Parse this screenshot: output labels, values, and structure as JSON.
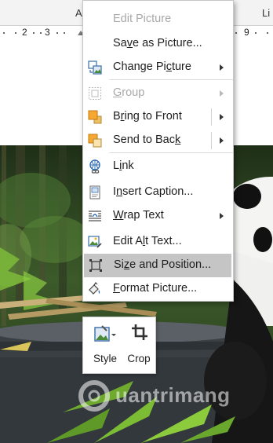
{
  "ribbon": {
    "frag_left": "A",
    "frag_right": "Li"
  },
  "ruler": {
    "numbers": [
      "2",
      "3",
      "9"
    ]
  },
  "context_menu": {
    "items": [
      {
        "label": "Edit Picture",
        "disabled": true,
        "submenu": false,
        "icon": "none"
      },
      {
        "label": "Save as Picture...",
        "disabled": false,
        "submenu": false,
        "icon": "none"
      },
      {
        "label": "Change Picture",
        "disabled": false,
        "submenu": true,
        "icon": "change-picture-icon"
      },
      {
        "label": "Group",
        "disabled": true,
        "submenu": true,
        "icon": "group-icon"
      },
      {
        "label": "Bring to Front",
        "disabled": false,
        "submenu": true,
        "split": true,
        "icon": "bring-to-front-icon"
      },
      {
        "label": "Send to Back",
        "disabled": false,
        "submenu": true,
        "split": true,
        "icon": "send-to-back-icon"
      },
      {
        "label": "Link",
        "disabled": false,
        "submenu": false,
        "icon": "link-icon"
      },
      {
        "label": "Insert Caption...",
        "disabled": false,
        "submenu": false,
        "icon": "insert-caption-icon"
      },
      {
        "label": "Wrap Text",
        "disabled": false,
        "submenu": true,
        "icon": "wrap-text-icon"
      },
      {
        "label": "Edit Alt Text...",
        "disabled": false,
        "submenu": false,
        "icon": "alt-text-icon"
      },
      {
        "label": "Size and Position...",
        "disabled": false,
        "submenu": false,
        "highlight": true,
        "icon": "size-position-icon"
      },
      {
        "label": "Format Picture...",
        "disabled": false,
        "submenu": false,
        "icon": "format-picture-icon"
      }
    ]
  },
  "mini_toolbar": {
    "style_label": "Style",
    "crop_label": "Crop"
  },
  "watermark": {
    "text": "uantrimang"
  },
  "colors": {
    "highlight": "#c5c5c5",
    "annotation_arrow": "#e2231a",
    "disabled_text": "#a8a8a8"
  }
}
